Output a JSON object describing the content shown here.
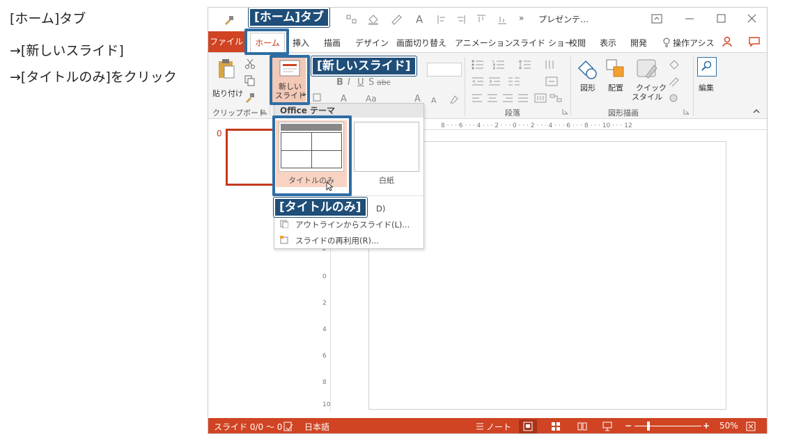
{
  "instructions": [
    "[ホーム]タブ",
    "→[新しいスライド]",
    "→[タイトルのみ]をクリック"
  ],
  "window": {
    "title": "プレゼンテ…",
    "more": "»"
  },
  "tabs": {
    "file": "ファイル",
    "home": "ホーム",
    "items": [
      "挿入",
      "描画",
      "デザイン",
      "画面切り替え",
      "アニメーション",
      "スライド ショー",
      "校閲",
      "表示",
      "開発"
    ],
    "tell_me": "操作アシス"
  },
  "ribbon": {
    "paste": "貼り付け",
    "new_slide_line1": "新しい",
    "new_slide_line2": "スライド",
    "clipboard_group": "クリップボード",
    "paragraph_group": "段落",
    "drawing_group": "図形描画",
    "shapes": "図形",
    "arrange": "配置",
    "quick_style_line1": "クイック",
    "quick_style_line2": "スタイル",
    "editing": "編集"
  },
  "ruler": {
    "h_text": "8 · · · 6 · · · 4 · · · 2 · · · 0 · · · 2 · · · 4 · · · 6 · · · 8 · · · 10 · · · 12",
    "v_ticks": [
      "8",
      "6",
      "4",
      "2",
      "0",
      "2",
      "4",
      "6",
      "8",
      "10"
    ]
  },
  "thumbs": {
    "slide_number": "0"
  },
  "dropdown": {
    "header": "Office テーマ",
    "layouts": [
      {
        "caption": "タイトルのみ"
      },
      {
        "caption": "白紙"
      }
    ],
    "partial_item": "D)",
    "items": [
      "アウトラインからスライド(L)...",
      "スライドの再利用(R)..."
    ]
  },
  "status": {
    "slide": "スライド 0/0 〜 0",
    "language": "日本語",
    "notes": "ノート",
    "zoom": "50%"
  },
  "callouts": {
    "home_tab": "[ホーム]タブ",
    "new_slide": "[新しいスライド]",
    "title_only": "[タイトルのみ]"
  },
  "colors": {
    "accent": "#d04423",
    "callout": "#1f4e79",
    "highlight": "#2e6da4",
    "hover": "#f9d3c2"
  }
}
